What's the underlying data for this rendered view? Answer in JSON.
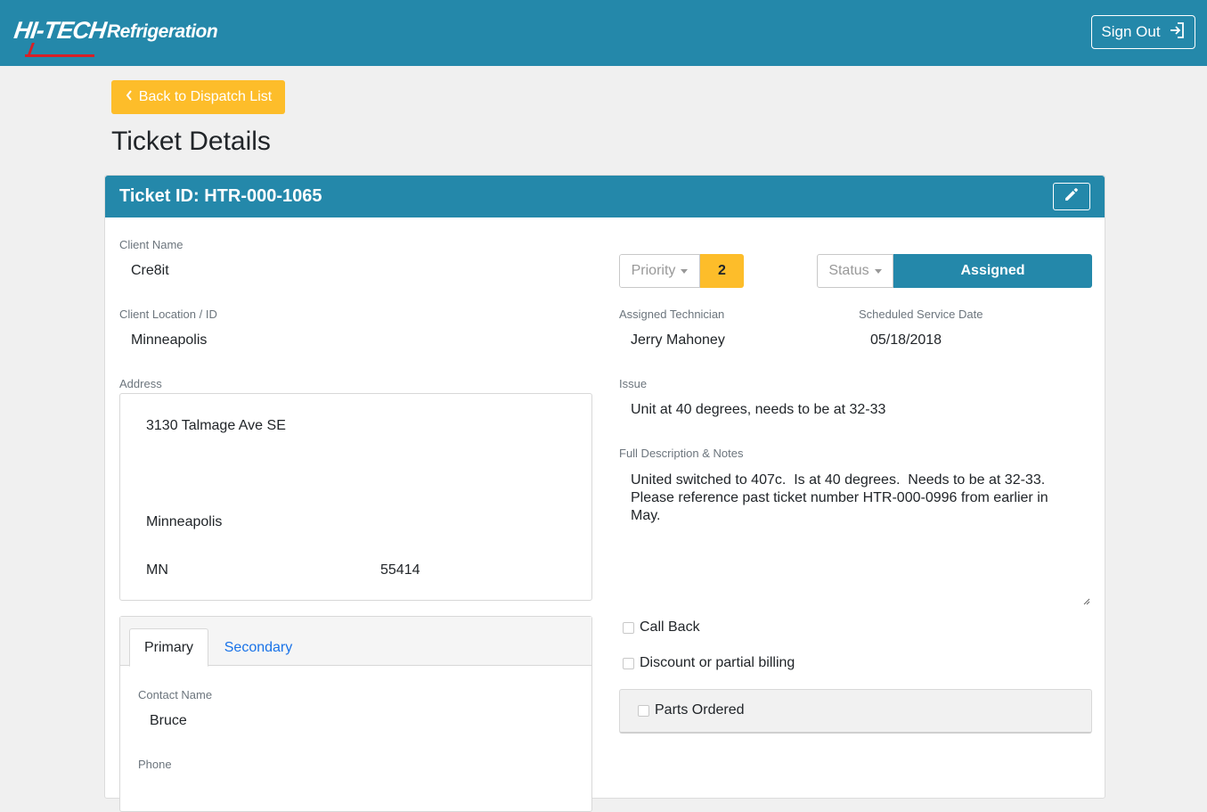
{
  "brand": {
    "logo_primary": "HI-TECH",
    "logo_secondary": "Refrigeration",
    "accent_color": "#2488aa",
    "logo_red": "#d72027"
  },
  "header": {
    "sign_out_label": "Sign Out",
    "sign_out_icon": "sign-out-icon"
  },
  "nav": {
    "back_label": "Back to Dispatch List",
    "back_icon": "chevron-left-icon",
    "back_color": "#fdbd2a"
  },
  "page": {
    "title": "Ticket Details"
  },
  "ticket": {
    "id_label": "Ticket ID: HTR-000-1065",
    "edit_icon": "pencil-icon",
    "client_name_label": "Client Name",
    "client_name": "Cre8it",
    "client_location_label": "Client Location / ID",
    "client_location": "Minneapolis",
    "address_label": "Address",
    "address": {
      "street": "3130 Talmage Ave SE",
      "city": "Minneapolis",
      "state": "MN",
      "zip": "55414"
    },
    "priority_label": "Priority",
    "priority_value": "2",
    "status_label": "Status",
    "status_value": "Assigned",
    "technician_label": "Assigned Technician",
    "technician": "Jerry Mahoney",
    "service_date_label": "Scheduled Service Date",
    "service_date": "05/18/2018",
    "issue_label": "Issue",
    "issue": "Unit at 40 degrees, needs to be at 32-33",
    "notes_label": "Full Description & Notes",
    "notes": "United switched to 407c.  Is at 40 degrees.  Needs to be at 32-33.  Please reference past ticket number HTR-000-0996 from earlier in May.",
    "call_back_label": "Call Back",
    "discount_label": "Discount or partial billing",
    "parts_ordered_label": "Parts Ordered"
  },
  "contact": {
    "tabs": [
      {
        "label": "Primary"
      },
      {
        "label": "Secondary"
      }
    ],
    "contact_name_label": "Contact Name",
    "contact_name": "Bruce",
    "phone_label": "Phone"
  }
}
